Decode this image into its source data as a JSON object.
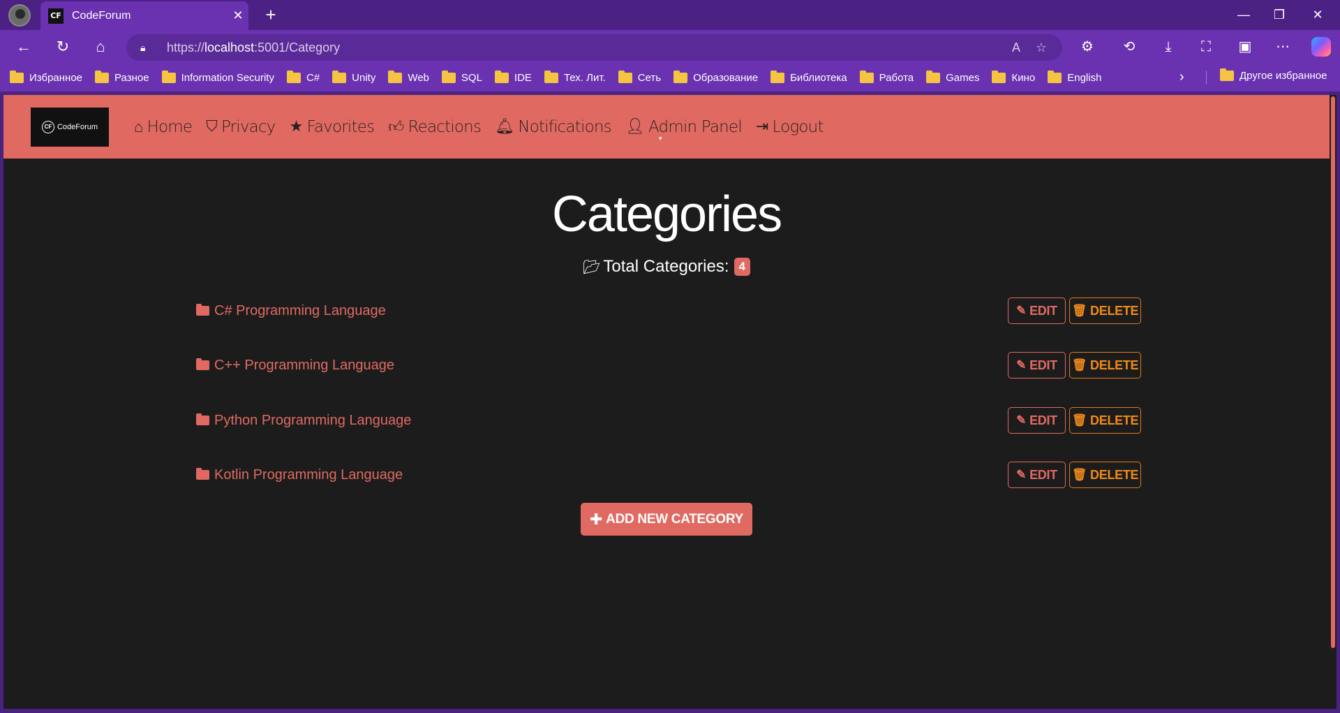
{
  "browser": {
    "tab_title": "CodeForum",
    "tab_favicon": "CF",
    "url_prefix": "https://",
    "url_host": "localhost",
    "url_rest": ":5001/Category"
  },
  "bookmarks": [
    {
      "label": "Избранное"
    },
    {
      "label": "Разное"
    },
    {
      "label": "Information Security"
    },
    {
      "label": "C#"
    },
    {
      "label": "Unity"
    },
    {
      "label": "Web"
    },
    {
      "label": "SQL"
    },
    {
      "label": "IDE"
    },
    {
      "label": "Тех. Лит."
    },
    {
      "label": "Сеть"
    },
    {
      "label": "Образование"
    },
    {
      "label": "Библиотека"
    },
    {
      "label": "Работа"
    },
    {
      "label": "Games"
    },
    {
      "label": "Кино"
    },
    {
      "label": "English"
    }
  ],
  "bookmarks_other": "Другое избранное",
  "site": {
    "brand_badge": "CF",
    "brand_name": "CodeForum",
    "nav": [
      {
        "label": "Home",
        "icon": "home-icon"
      },
      {
        "label": "Privacy",
        "icon": "shield-icon"
      },
      {
        "label": "Favorites",
        "icon": "star-icon"
      },
      {
        "label": "Reactions",
        "icon": "thumbs-up-icon"
      },
      {
        "label": "Notifications",
        "icon": "bell-icon"
      },
      {
        "label": "Admin Panel",
        "icon": "user-gear-icon"
      },
      {
        "label": "Logout",
        "icon": "sign-out-icon"
      }
    ]
  },
  "main": {
    "title": "Categories",
    "total_label": "Total Categories:",
    "total_count": "4",
    "categories": [
      {
        "name": "C# Programming Language"
      },
      {
        "name": "C++ Programming Language"
      },
      {
        "name": "Python Programming Language"
      },
      {
        "name": "Kotlin Programming Language"
      }
    ],
    "edit_label": "EDIT",
    "delete_label": "DELETE",
    "add_label": "ADD NEW CATEGORY"
  },
  "colors": {
    "accent": "#e06a62",
    "delete": "#f08a1a",
    "page_bg": "#1c1c1c",
    "browser_frame": "#6a32b0"
  }
}
